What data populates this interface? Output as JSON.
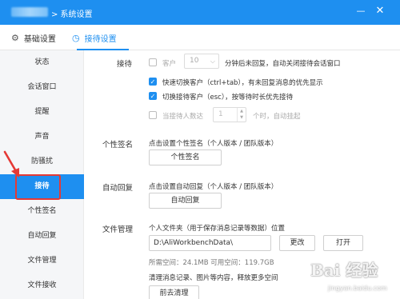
{
  "window": {
    "title": "> 系统设置",
    "minimize_icon": "minimize-icon",
    "close_icon": "close-icon"
  },
  "tabs": [
    {
      "label": "基础设置",
      "icon": "gear-icon"
    },
    {
      "label": "接待设置",
      "icon": "clock-icon",
      "active": true
    }
  ],
  "sidebar": {
    "items": [
      {
        "label": "状态"
      },
      {
        "label": "会话窗口"
      },
      {
        "label": "提醒"
      },
      {
        "label": "声音"
      },
      {
        "label": "防骚扰"
      },
      {
        "label": "接待",
        "active": true
      },
      {
        "label": "个性签名"
      },
      {
        "label": "自动回复"
      },
      {
        "label": "文件管理"
      },
      {
        "label": "文件接收"
      }
    ]
  },
  "reception": {
    "label": "接待",
    "option1": {
      "checked": false,
      "prefix": "客户",
      "select_value": "10",
      "suffix": "分钟后未回复，自动关闭接待会话窗口"
    },
    "option2": {
      "checked": true,
      "text": "快速切换客户（ctrl+tab），有未回复消息的优先显示"
    },
    "option3": {
      "checked": true,
      "text": "切换接待客户（esc），按等待时长优先接待"
    },
    "option4": {
      "checked": false,
      "prefix": "当接待人数达",
      "stepper_value": "1",
      "suffix": "个时，自动挂起"
    }
  },
  "signature": {
    "label": "个性签名",
    "desc": "点击设置个性签名（个人版本 / 团队版本）",
    "button": "个性签名"
  },
  "auto_reply": {
    "label": "自动回复",
    "desc": "点击设置自动回复（个人版本 / 团队版本）",
    "button": "自动回复"
  },
  "file_mgmt": {
    "label": "文件管理",
    "desc": "个人文件夹（用于保存消息记录等数据）位置",
    "path": "D:\\AliWorkbenchData\\",
    "change_button": "更改",
    "open_button": "打开",
    "space": "所需空间：24.1MB   可用空间：119.7GB",
    "clean_desc": "清理消息记录、图片等内容，释放更多空间",
    "clean_button": "前去清理"
  },
  "watermark": {
    "logo": "Bai 经验",
    "url": "jingyan.baidu.com"
  },
  "colors": {
    "accent": "#1e8ff0",
    "highlight_box": "#e53935"
  }
}
